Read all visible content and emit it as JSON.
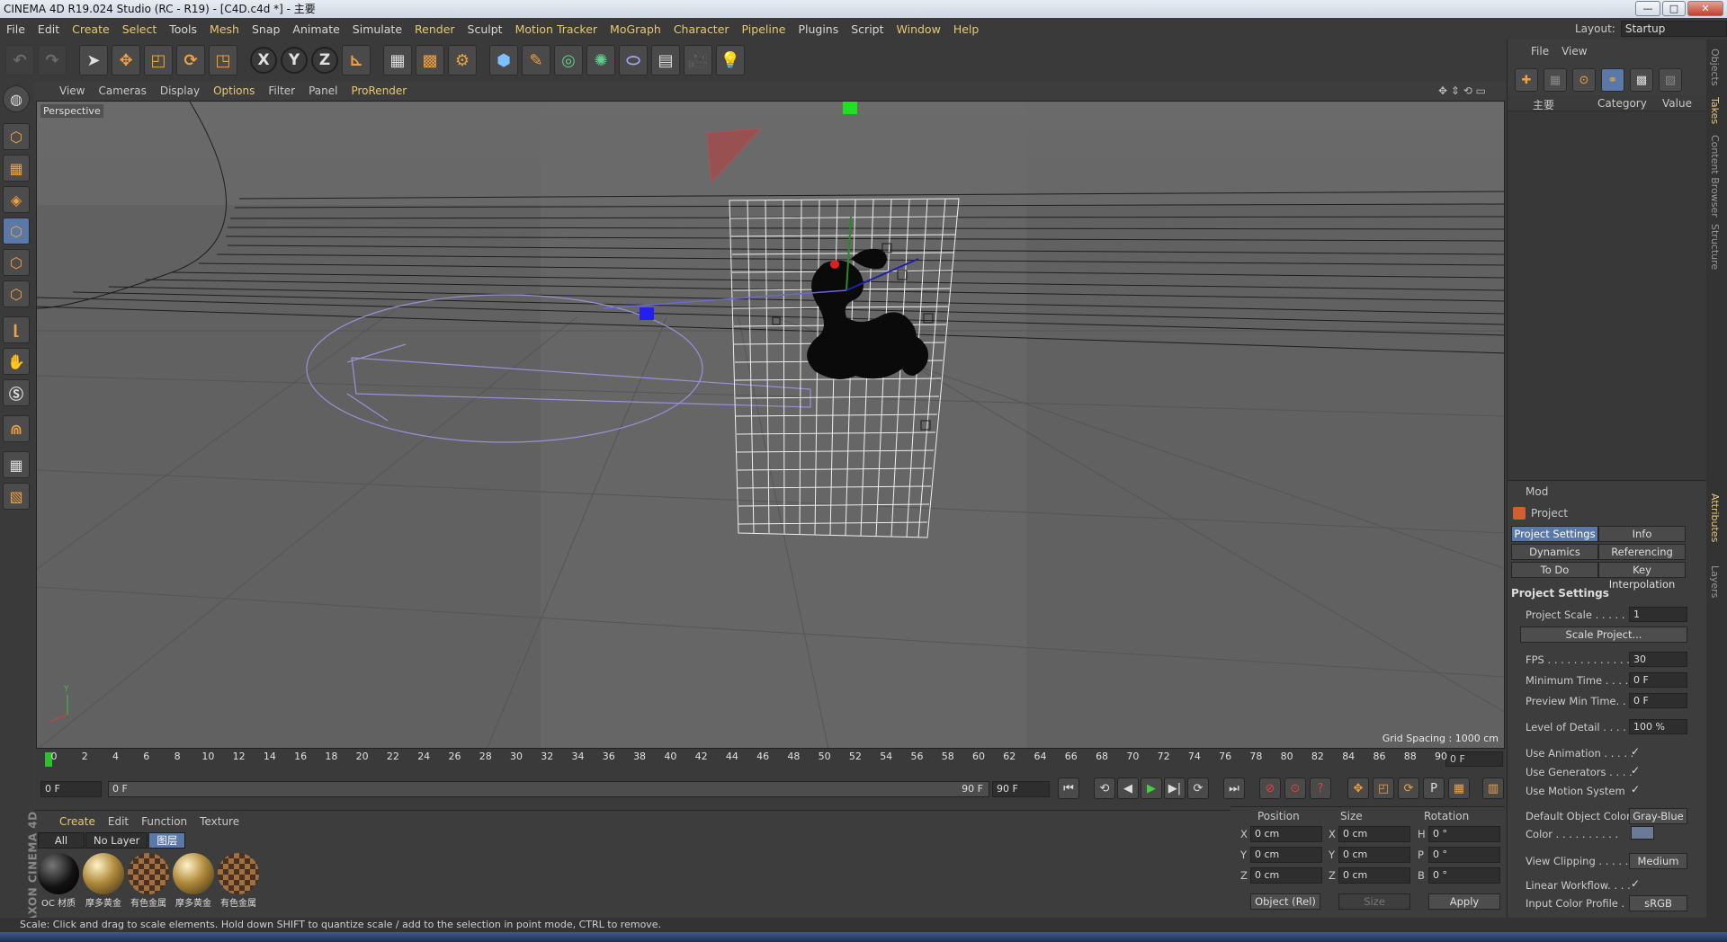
{
  "window": {
    "title": "CINEMA 4D R19.024 Studio (RC - R19) - [C4D.c4d *] - 主要",
    "min": "—",
    "max": "□",
    "close": "✕"
  },
  "menu": [
    "File",
    "Edit",
    "Create",
    "Select",
    "Tools",
    "Mesh",
    "Snap",
    "Animate",
    "Simulate",
    "Render",
    "Sculpt",
    "Motion Tracker",
    "MoGraph",
    "Character",
    "Pipeline",
    "Plugins",
    "Script",
    "Window",
    "Help"
  ],
  "layout": {
    "label": "Layout:",
    "value": "Startup"
  },
  "viewport": {
    "menu": [
      "View",
      "Cameras",
      "Display",
      "Options",
      "Filter",
      "Panel",
      "ProRender"
    ],
    "label": "Perspective",
    "grid_spacing": "Grid Spacing : 1000 cm"
  },
  "timeline": {
    "ticks": [
      "0",
      "2",
      "4",
      "6",
      "8",
      "10",
      "12",
      "14",
      "16",
      "18",
      "20",
      "22",
      "24",
      "26",
      "28",
      "30",
      "32",
      "34",
      "36",
      "38",
      "40",
      "42",
      "44",
      "46",
      "48",
      "50",
      "52",
      "54",
      "56",
      "58",
      "60",
      "62",
      "64",
      "66",
      "68",
      "70",
      "72",
      "74",
      "76",
      "78",
      "80",
      "82",
      "84",
      "86",
      "88",
      "90"
    ],
    "current": "0 F"
  },
  "transport": {
    "start": "0 F",
    "range_start": "0 F",
    "range_end": "90 F",
    "end": "90 F"
  },
  "materials": {
    "menu": [
      "Create",
      "Edit",
      "Function",
      "Texture"
    ],
    "filters": [
      "All",
      "No Layer",
      "图层"
    ],
    "items": [
      {
        "label": "OC 材质",
        "color": "#111111"
      },
      {
        "label": "摩多黄金",
        "color": "#b08a3c"
      },
      {
        "label": "有色金属",
        "color": "#8a6038"
      },
      {
        "label": "摩多黄金",
        "color": "#b08a3c"
      },
      {
        "label": "有色金属",
        "color": "#8a6038"
      }
    ]
  },
  "coords": {
    "headers": [
      "Position",
      "Size",
      "Rotation"
    ],
    "rows": [
      {
        "a": "X",
        "pos": "0 cm",
        "b": "X",
        "size": "0 cm",
        "c": "H",
        "rot": "0 °"
      },
      {
        "a": "Y",
        "pos": "0 cm",
        "b": "Y",
        "size": "0 cm",
        "c": "P",
        "rot": "0 °"
      },
      {
        "a": "Z",
        "pos": "0 cm",
        "b": "Z",
        "size": "0 cm",
        "c": "B",
        "rot": "0 °"
      }
    ],
    "mode": "Object (Rel)",
    "size_mode": "Size",
    "apply": "Apply"
  },
  "status": "Scale: Click and drag to scale elements. Hold down SHIFT to quantize scale / add to the selection in point mode, CTRL to remove.",
  "objects": {
    "menu": [
      "File",
      "View"
    ],
    "root": "主要",
    "cols": [
      "Category",
      "Value"
    ]
  },
  "attributes": {
    "mode": "Mod",
    "object": "Project",
    "tabs": [
      "Project Settings",
      "Info",
      "Dynamics",
      "Referencing",
      "To Do",
      "Key Interpolation"
    ],
    "section": "Project Settings",
    "project_scale": {
      "label": "Project Scale . . . . . .",
      "value": "1"
    },
    "scale_btn": "Scale Project...",
    "fps": {
      "label": "FPS . . . . . . . . . . . . . .",
      "value": "30"
    },
    "min_time": {
      "label": "Minimum Time . . . . .",
      "value": "0 F"
    },
    "prev_min": {
      "label": "Preview Min Time. . . .",
      "value": "0 F"
    },
    "lod": {
      "label": "Level of Detail . . . . .",
      "value": "100 %"
    },
    "use_anim": "Use Animation . . . . .",
    "use_gen": "Use Generators . . . .",
    "use_motion": "Use Motion System",
    "def_color": {
      "label": "Default Object Color",
      "value": "Gray-Blue"
    },
    "color": "Color . . . . . . . . . .",
    "view_clip": {
      "label": "View Clipping . . . . .",
      "value": "Medium"
    },
    "linear": "Linear Workflow. . . .",
    "icp": {
      "label": "Input Color Profile . .",
      "value": "sRGB"
    },
    "check": "✓"
  },
  "side_tabs": [
    "Objects",
    "Takes",
    "Content Browser",
    "Structure",
    "Attributes",
    "Layers"
  ],
  "maxon": "MAXON CINEMA 4D"
}
